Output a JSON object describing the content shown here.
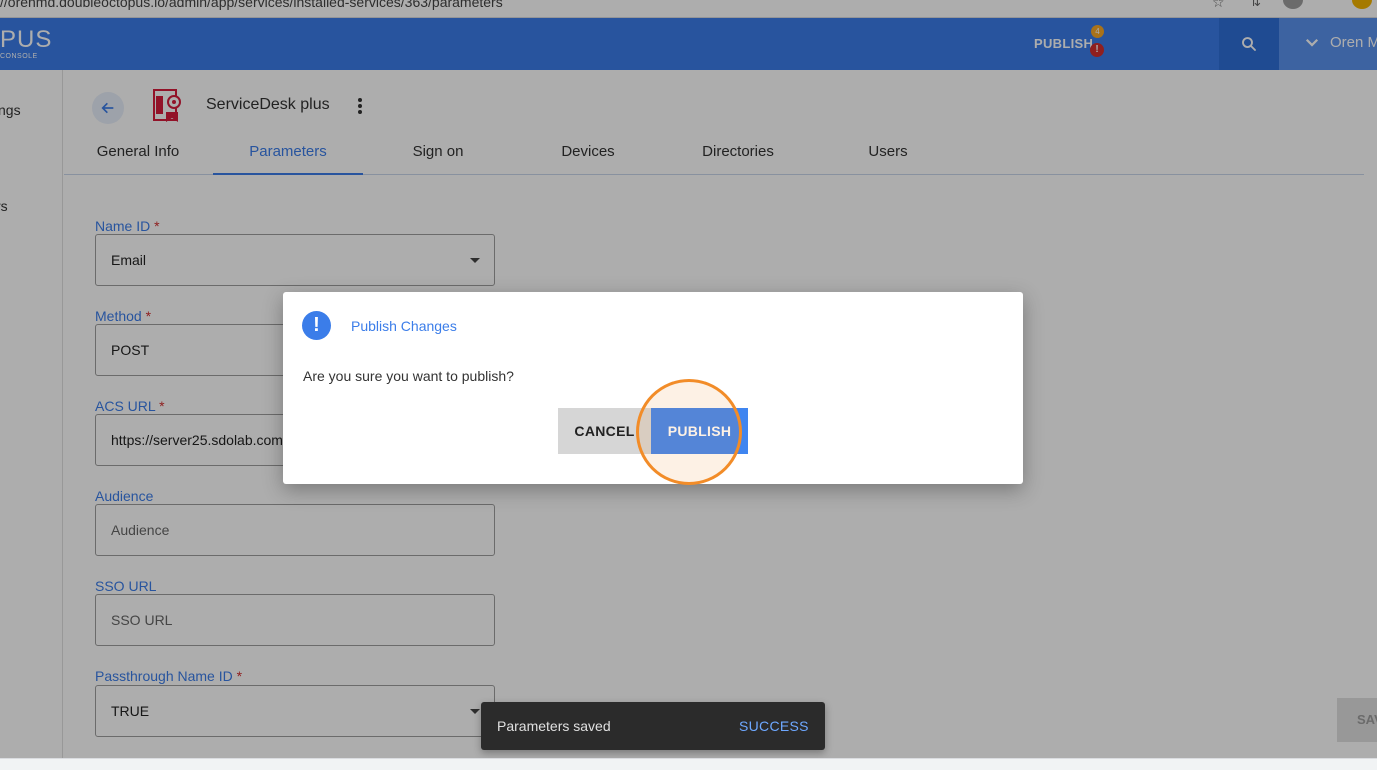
{
  "browser": {
    "url": "//orenmd.doubleoctopus.io/admin/app/services/installed-services/363/parameters"
  },
  "header": {
    "logo_text": "PUS",
    "logo_sub": "CONSOLE",
    "publish_label": "PUBLISH",
    "badge_count": "4",
    "badge_alert": "!",
    "user_name": "Oren M",
    "brand_color": "#3b7de9"
  },
  "sidebar": {
    "items": [
      "ngs",
      "rs"
    ]
  },
  "service": {
    "name": "ServiceDesk plus"
  },
  "tabs": [
    {
      "label": "General Info"
    },
    {
      "label": "Parameters"
    },
    {
      "label": "Sign on"
    },
    {
      "label": "Devices"
    },
    {
      "label": "Directories"
    },
    {
      "label": "Users"
    }
  ],
  "active_tab": "Parameters",
  "form": {
    "name_id": {
      "label": "Name ID",
      "required": "*",
      "value": "Email"
    },
    "method": {
      "label": "Method",
      "required": "*",
      "value": "POST"
    },
    "acs_url": {
      "label": "ACS URL",
      "required": "*",
      "value": "https://server25.sdolab.com"
    },
    "audience": {
      "label": "Audience",
      "placeholder": "Audience"
    },
    "sso_url": {
      "label": "SSO URL",
      "placeholder": "SSO URL"
    },
    "passthrough": {
      "label": "Passthrough Name ID",
      "required": "*",
      "value": "TRUE"
    },
    "save_label": "SAVE"
  },
  "dialog": {
    "title": "Publish Changes",
    "message": "Are you sure you want to publish?",
    "cancel_label": "CANCEL",
    "publish_label": "PUBLISH",
    "icon_glyph": "!"
  },
  "snackbar": {
    "message": "Parameters saved",
    "action": "SUCCESS"
  }
}
